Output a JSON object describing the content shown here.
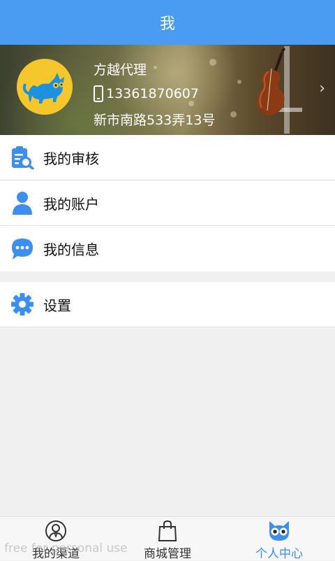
{
  "header": {
    "title": "我"
  },
  "profile": {
    "name": "方越代理",
    "phone": "13361870607",
    "address": "新市南路533弄13号",
    "arrow": "›"
  },
  "menu": {
    "items": [
      {
        "label": "我的审核",
        "icon": "review-search-icon"
      },
      {
        "label": "我的账户",
        "icon": "user-icon"
      },
      {
        "label": "我的信息",
        "icon": "chat-bubble-icon"
      }
    ],
    "settings": {
      "label": "设置",
      "icon": "gear-icon"
    }
  },
  "tabbar": {
    "tabs": [
      {
        "label": "我的渠道",
        "icon": "agent-avatar-icon"
      },
      {
        "label": "商城管理",
        "icon": "shopping-bag-icon"
      },
      {
        "label": "个人中心",
        "icon": "cat-face-icon"
      }
    ],
    "active_index": 2
  },
  "watermark": "free for personal use",
  "colors": {
    "accent": "#4a9bf2",
    "avatar_bg": "#f6c72c",
    "active_tab": "#3a8ff0"
  }
}
